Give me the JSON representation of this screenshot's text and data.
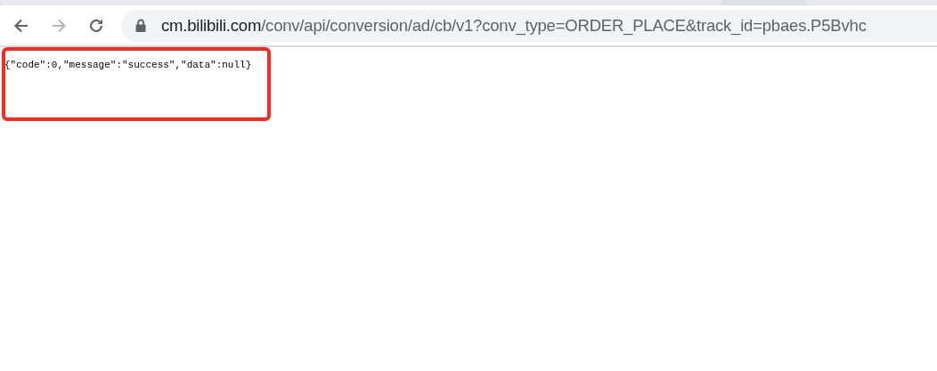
{
  "address_bar": {
    "host": "cm.bilibili.com",
    "path": "/conv/api/conversion/ad/cb/v1?conv_type=ORDER_PLACE&track_id=pbaes.P5Bvhc"
  },
  "page": {
    "response_text": "{\"code\":0,\"message\":\"success\",\"data\":null}",
    "highlighted": true
  }
}
